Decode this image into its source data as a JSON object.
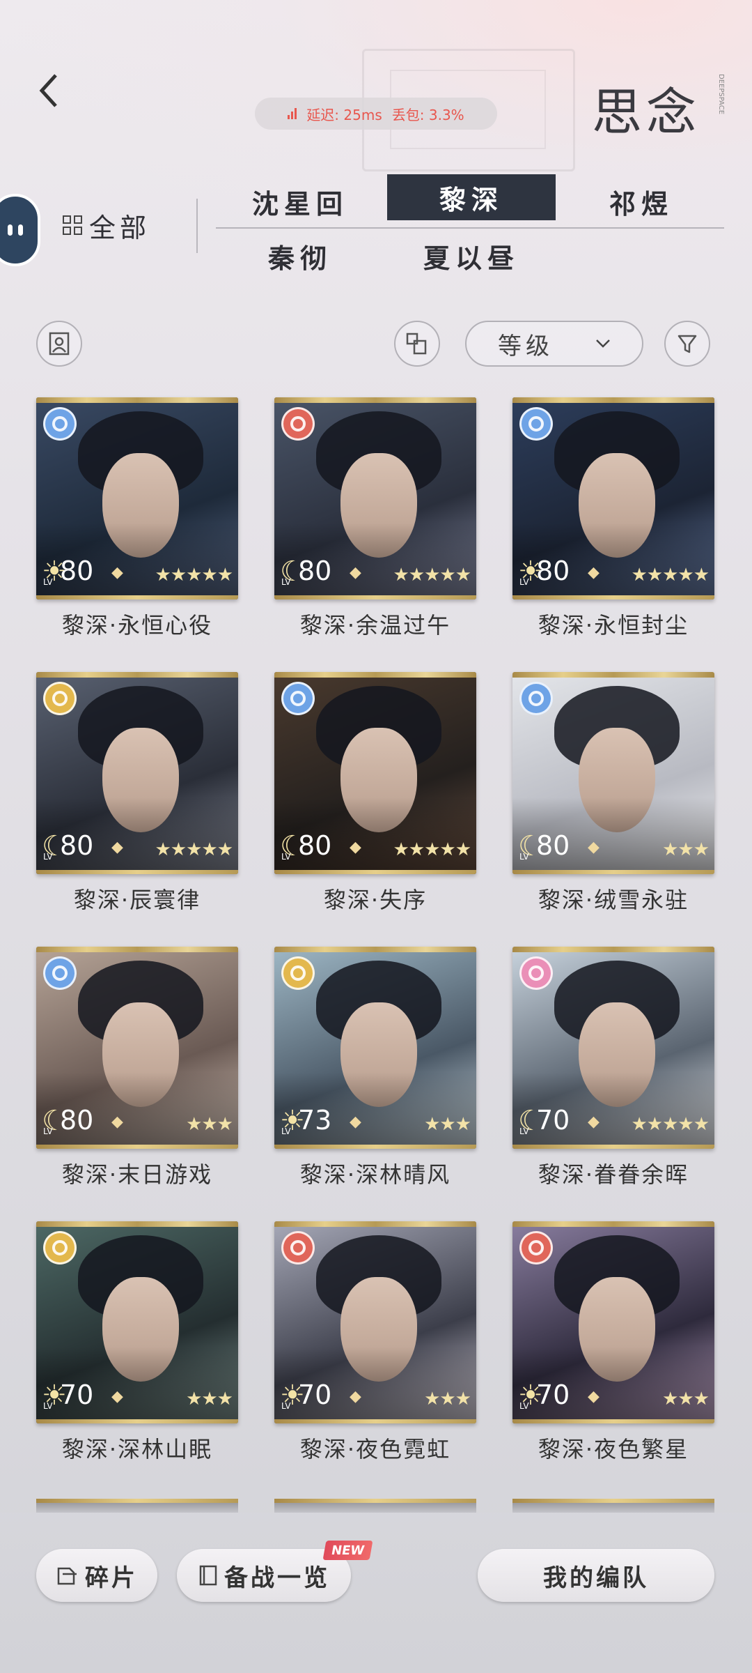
{
  "header": {
    "title": "思念",
    "sub_brand": "DEEPSPACE",
    "latency": {
      "delay_label": "延迟: 25ms",
      "loss_label": "丢包: 3.3%"
    }
  },
  "filters": {
    "all_label": "全部",
    "tabs": [
      {
        "label": "沈星回",
        "active": false
      },
      {
        "label": "黎深",
        "active": true
      },
      {
        "label": "祁煜",
        "active": false
      },
      {
        "label": "秦彻",
        "active": false
      },
      {
        "label": "夏以昼",
        "active": false
      }
    ]
  },
  "toolbar": {
    "sort_label": "等级"
  },
  "cards": [
    {
      "name": "黎深·永恒心役",
      "level": "80",
      "lv_text": "LV",
      "element": "blue",
      "lv_icon": "sun",
      "stars": "★★★★★"
    },
    {
      "name": "黎深·余温过午",
      "level": "80",
      "lv_text": "LV",
      "element": "red",
      "lv_icon": "moon",
      "stars": "★★★★★"
    },
    {
      "name": "黎深·永恒封尘",
      "level": "80",
      "lv_text": "LV",
      "element": "blue",
      "lv_icon": "sun",
      "stars": "★★★★★"
    },
    {
      "name": "黎深·辰寰律",
      "level": "80",
      "lv_text": "LV",
      "element": "gold",
      "lv_icon": "moon",
      "stars": "★★★★★"
    },
    {
      "name": "黎深·失序",
      "level": "80",
      "lv_text": "LV",
      "element": "blue",
      "lv_icon": "moon",
      "stars": "★★★★★"
    },
    {
      "name": "黎深·绒雪永驻",
      "level": "80",
      "lv_text": "LV",
      "element": "blue",
      "lv_icon": "moon",
      "stars": "★★★"
    },
    {
      "name": "黎深·末日游戏",
      "level": "80",
      "lv_text": "LV",
      "element": "blue",
      "lv_icon": "moon",
      "stars": "★★★"
    },
    {
      "name": "黎深·深林晴风",
      "level": "73",
      "lv_text": "LV",
      "element": "gold",
      "lv_icon": "sun",
      "stars": "★★★"
    },
    {
      "name": "黎深·眷眷余晖",
      "level": "70",
      "lv_text": "LV",
      "element": "pink",
      "lv_icon": "moon",
      "stars": "★★★★★"
    },
    {
      "name": "黎深·深林山眠",
      "level": "70",
      "lv_text": "LV",
      "element": "gold",
      "lv_icon": "sun",
      "stars": "★★★"
    },
    {
      "name": "黎深·夜色霓虹",
      "level": "70",
      "lv_text": "LV",
      "element": "red",
      "lv_icon": "sun",
      "stars": "★★★"
    },
    {
      "name": "黎深·夜色繁星",
      "level": "70",
      "lv_text": "LV",
      "element": "red",
      "lv_icon": "sun",
      "stars": "★★★"
    }
  ],
  "colors": {
    "blue": "#6ea3e6",
    "red": "#e0665a",
    "gold": "#e3b84d",
    "pink": "#ea8fb7"
  },
  "bottom": {
    "fragments_label": "碎片",
    "battle_prep_label": "备战一览",
    "new_badge": "NEW",
    "my_team_label": "我的编队"
  }
}
